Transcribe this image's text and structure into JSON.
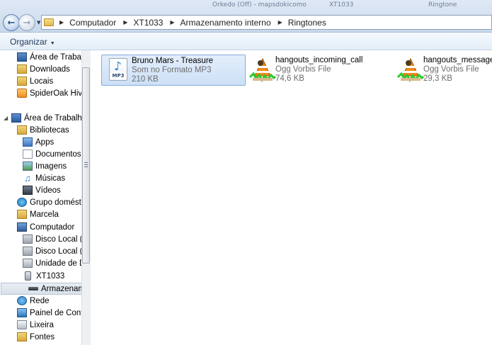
{
  "window": {
    "background_tabs": [
      "Orkedo (Off) - mapsdokicomo",
      "XT1033",
      "Ringtone"
    ]
  },
  "address": {
    "crumbs": [
      "Computador",
      "XT1033",
      "Armazenamento interno",
      "Ringtones"
    ]
  },
  "toolbar": {
    "organize_label": "Organizar"
  },
  "nav": {
    "favorites": [
      {
        "label": "Área de Trabalho",
        "icon": "desktop-icon"
      },
      {
        "label": "Downloads",
        "icon": "downloads-icon"
      },
      {
        "label": "Locais",
        "icon": "recent-places-icon"
      },
      {
        "label": "SpiderOak Hive",
        "icon": "spideroak-icon"
      }
    ],
    "desktop_root": {
      "label": "Área de Trabalho",
      "icon": "desktop-icon"
    },
    "libraries": {
      "label": "Bibliotecas",
      "icon": "libraries-icon"
    },
    "library_items": [
      {
        "label": "Apps",
        "icon": "apps-icon"
      },
      {
        "label": "Documentos",
        "icon": "documents-icon"
      },
      {
        "label": "Imagens",
        "icon": "images-icon"
      },
      {
        "label": "Músicas",
        "icon": "music-icon"
      },
      {
        "label": "Vídeos",
        "icon": "videos-icon"
      }
    ],
    "homegroup": {
      "label": "Grupo doméstico",
      "icon": "homegroup-icon"
    },
    "user": {
      "label": "Marcela",
      "icon": "user-folder-icon"
    },
    "computer": {
      "label": "Computador",
      "icon": "computer-icon"
    },
    "drives": [
      {
        "label": "Disco Local (C:)",
        "icon": "drive-c-icon"
      },
      {
        "label": "Disco Local (D:)",
        "icon": "drive-d-icon"
      },
      {
        "label": "Unidade de DVD",
        "icon": "dvd-drive-icon"
      },
      {
        "label": "XT1033",
        "icon": "phone-icon"
      }
    ],
    "selected_storage": {
      "label": "Armazenamento interno",
      "icon": "storage-icon"
    },
    "tail": [
      {
        "label": "Rede",
        "icon": "network-icon"
      },
      {
        "label": "Painel de Controle",
        "icon": "control-panel-icon"
      },
      {
        "label": "Lixeira",
        "icon": "recycle-bin-icon"
      },
      {
        "label": "Fontes",
        "icon": "fonts-icon"
      }
    ]
  },
  "files": [
    {
      "name": "Bruno Mars - Treasure",
      "type": "Som no Formato MP3",
      "size": "210 KB",
      "icon": "mp3-file-icon",
      "selected": true
    },
    {
      "name": "hangouts_incoming_call",
      "type": "Ogg Vorbis File",
      "size": "74,6 KB",
      "icon": "vlc-ogg-file-icon",
      "selected": false
    },
    {
      "name": "hangouts_message",
      "type": "Ogg Vorbis File",
      "size": "29,3 KB",
      "icon": "vlc-ogg-file-icon",
      "selected": false
    }
  ]
}
